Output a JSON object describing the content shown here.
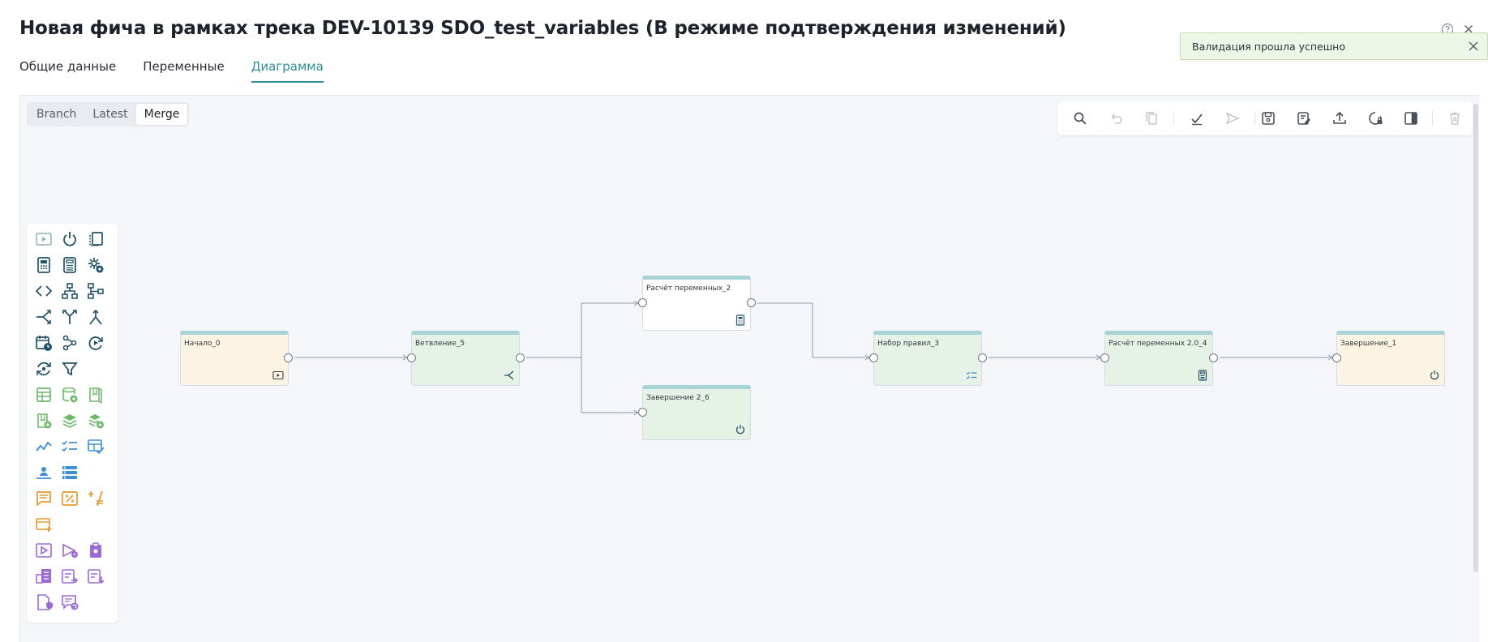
{
  "page": {
    "title": "Новая фича в рамках трека DEV-10139 SDO_test_variables (В режиме подтверждения изменений)"
  },
  "tabs": [
    {
      "label": "Общие данные",
      "active": false
    },
    {
      "label": "Переменные",
      "active": false
    },
    {
      "label": "Диаграмма",
      "active": true
    }
  ],
  "toast": {
    "message": "Валидация прошла успешно"
  },
  "version_switch": {
    "options": [
      "Branch",
      "Latest",
      "Merge"
    ],
    "selected": "Merge"
  },
  "toolbar": {
    "buttons": [
      "search-icon",
      "undo-icon",
      "copy-icon",
      "validate-check-icon",
      "send-icon",
      "save-icon",
      "save-as-icon",
      "upload-icon",
      "settings-lock-icon",
      "side-panel-icon",
      "delete-icon"
    ]
  },
  "palette": {
    "groups": [
      {
        "color": "#2b5f73",
        "icons": [
          "start-icon",
          "power-icon",
          "copy-node-icon",
          "calculator-icon",
          "calculator-2-icon",
          "gear-plus-icon",
          "code-icon",
          "hierarchy-icon",
          "tree-icon",
          "branch-icon",
          "split-icon",
          "merge-icon",
          "calendar-clock-icon",
          "nodes-icon",
          "refresh-play-icon",
          "refresh-gear-icon",
          "filter-icon"
        ]
      },
      {
        "color": "#6dba6a",
        "icons": [
          "table-icon",
          "database-plus-icon",
          "book-icon",
          "book-plus-icon",
          "layers-icon",
          "layers-plus-icon"
        ]
      },
      {
        "color": "#3e8fd6",
        "icons": [
          "trend-icon",
          "checklist-icon",
          "table-check-icon",
          "user-tray-icon",
          "list-icon"
        ]
      },
      {
        "color": "#e89a2c",
        "icons": [
          "comment-icon",
          "percent-box-icon",
          "percent-slash-icon",
          "window-plus-icon"
        ]
      },
      {
        "color": "#9b6ad6",
        "icons": [
          "play-box-icon",
          "send-box-icon",
          "clipboard-icon",
          "building-icon",
          "doc-arrow-icon",
          "doc-download-icon",
          "doc-shield-icon",
          "comment-refresh-icon"
        ]
      }
    ]
  },
  "diagram": {
    "nodes": [
      {
        "id": "start",
        "label": "Начало_0",
        "icon": "play-box-icon",
        "style": "start"
      },
      {
        "id": "branch",
        "label": "Ветвление_5",
        "icon": "branch-icon",
        "style": "green"
      },
      {
        "id": "calc2",
        "label": "Расчёт переменных_2",
        "icon": "calculator-icon",
        "style": "white"
      },
      {
        "id": "end26",
        "label": "Завершение 2_6",
        "icon": "power-icon",
        "style": "green"
      },
      {
        "id": "rules3",
        "label": "Набор правил_3",
        "icon": "checklist-icon",
        "style": "green"
      },
      {
        "id": "calc24",
        "label": "Расчёт переменных 2.0_4",
        "icon": "calculator-icon",
        "style": "green"
      },
      {
        "id": "end1",
        "label": "Завершение_1",
        "icon": "power-icon",
        "style": "start"
      }
    ]
  }
}
